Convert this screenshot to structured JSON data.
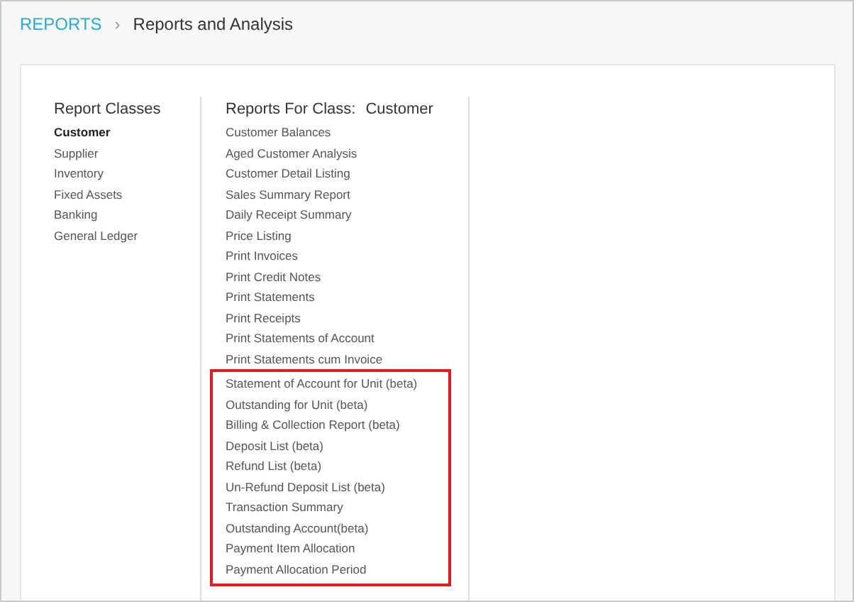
{
  "breadcrumb": {
    "root": "REPORTS",
    "separator": "›",
    "current": "Reports and Analysis"
  },
  "report_classes": {
    "title": "Report Classes",
    "items": [
      {
        "label": "Customer",
        "selected": true
      },
      {
        "label": "Supplier",
        "selected": false
      },
      {
        "label": "Inventory",
        "selected": false
      },
      {
        "label": "Fixed Assets",
        "selected": false
      },
      {
        "label": "Banking",
        "selected": false
      },
      {
        "label": "General Ledger",
        "selected": false
      }
    ]
  },
  "reports": {
    "title_label": "Reports For Class:",
    "title_class": "Customer",
    "items": [
      "Customer Balances",
      "Aged Customer Analysis",
      "Customer Detail Listing",
      "Sales Summary Report",
      "Daily Receipt Summary",
      "Price Listing",
      "Print Invoices",
      "Print Credit Notes",
      "Print Statements",
      "Print Receipts",
      "Print Statements of Account",
      "Print Statements cum Invoice"
    ],
    "highlighted_items": [
      "Statement of Account for Unit (beta)",
      "Outstanding for Unit (beta)",
      "Billing & Collection Report (beta)",
      "Deposit List (beta)",
      "Refund List (beta)",
      "Un-Refund Deposit List (beta)",
      "Transaction Summary",
      "Outstanding Account(beta)",
      "Payment Item Allocation",
      "Payment Allocation Period"
    ]
  }
}
